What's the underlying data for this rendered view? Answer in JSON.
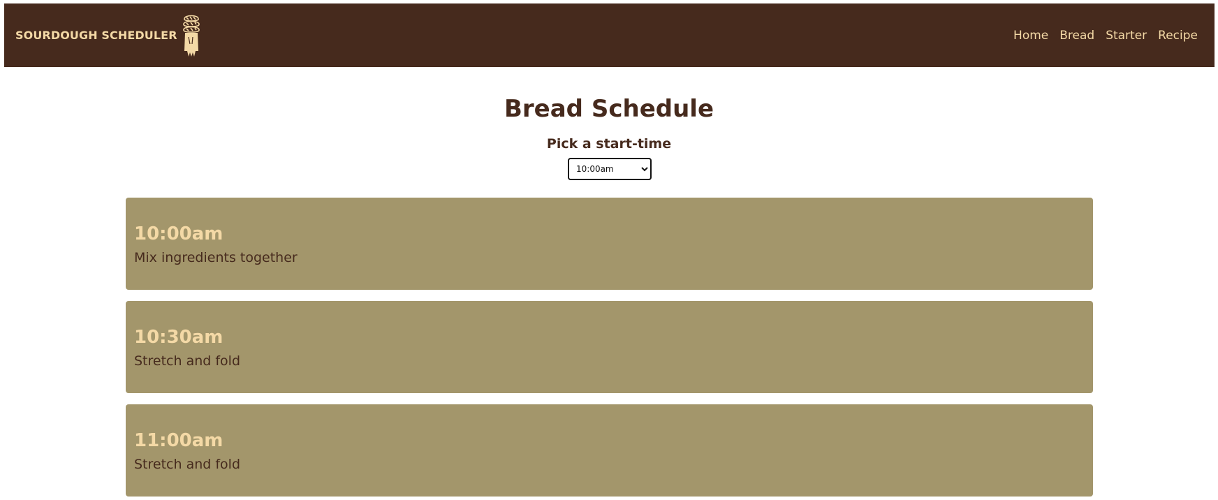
{
  "navbar": {
    "brand": "SOURDOUGH SCHEDULER",
    "logo_icon": "bread-loaf-icon",
    "links": [
      {
        "label": "Home"
      },
      {
        "label": "Bread"
      },
      {
        "label": "Starter"
      },
      {
        "label": "Recipe"
      }
    ]
  },
  "main": {
    "title": "Bread Schedule",
    "picker_label": "Pick a start-time",
    "start_time_selected": "10:00am",
    "schedule": [
      {
        "time": "10:00am",
        "step": "Mix ingredients together"
      },
      {
        "time": "10:30am",
        "step": "Stretch and fold"
      },
      {
        "time": "11:00am",
        "step": "Stretch and fold"
      }
    ]
  },
  "colors": {
    "navbar_bg": "#462a1d",
    "accent_text": "#f4d9a6",
    "card_bg": "#a3966b",
    "heading": "#462a1d"
  }
}
